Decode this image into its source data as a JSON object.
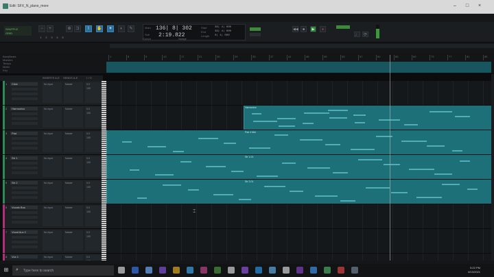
{
  "window": {
    "title": "Edit: SFX_N_plano_more",
    "min": "–",
    "max": "□",
    "close": "×"
  },
  "toolbar": {
    "mode_line1": "SHUFFLE",
    "mode_line2": "GRID",
    "grid_numbers": [
      "1",
      "2",
      "3",
      "4",
      "5"
    ],
    "counter": {
      "main_label": "Main",
      "sub_label": "Sub",
      "main_value": "136| 8| 302",
      "sub_value": "2:19.822",
      "start_label": "Start",
      "end_label": "End",
      "length_label": "Length",
      "start_value": "38| 4| 000",
      "end_value": "39| 4| 000",
      "length_value": "0| 1| 000",
      "nudge_label": "Nudge"
    },
    "cursor_label": "Cursor"
  },
  "rulers": {
    "row_labels": [
      "Bars|Beats",
      "Markers",
      "Tempo",
      "Meter",
      "Key"
    ],
    "bar_numbers": [
      "1",
      "5",
      "9",
      "13",
      "17",
      "21",
      "25",
      "29",
      "33",
      "37",
      "41",
      "45",
      "49",
      "53",
      "57",
      "61",
      "65",
      "69",
      "73",
      "77",
      "81",
      "85"
    ]
  },
  "columns": [
    "INSERTS A-E",
    "SENDS A-E",
    "I / O"
  ],
  "tracks": [
    {
      "num": "1",
      "name": "Click",
      "color": "#2e8b57",
      "region": null
    },
    {
      "num": "2",
      "name": "Harmonics",
      "color": "#2e8b57",
      "region": "Harmonics"
    },
    {
      "num": "3",
      "name": "Pad",
      "color": "#2e8b57",
      "region": "Pad 4 Mid"
    },
    {
      "num": "4",
      "name": "Str 1",
      "color": "#2e8b57",
      "region": "Str 1-01"
    },
    {
      "num": "5",
      "name": "Str 2",
      "color": "#2e8b57",
      "region": "Str 2-01"
    },
    {
      "num": "6",
      "name": "Vocals Bus",
      "color": "#b0307a",
      "region": null
    },
    {
      "num": "7",
      "name": "Vocal Aux 2",
      "color": "#b0307a",
      "region": null
    },
    {
      "num": "8",
      "name": "Vox 1",
      "color": "#b0307a",
      "region": null
    }
  ],
  "track_io": {
    "input": "No Input",
    "output": "Master",
    "volume": "0.0",
    "pan": "100"
  },
  "taskbar": {
    "search_placeholder": "Type here to search",
    "time": "5:22 PM",
    "date": "6/10/2021"
  },
  "colors": {
    "accent": "#2b6f9a",
    "region": "#1d6f78",
    "play": "#2f8a3a"
  }
}
